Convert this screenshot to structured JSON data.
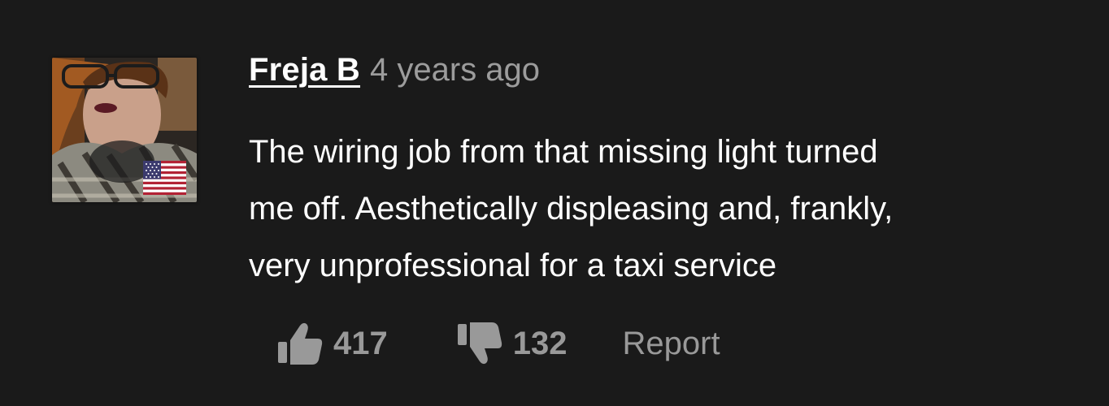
{
  "comment": {
    "author": "Freja B",
    "timestamp": "4 years ago",
    "body_lines": [
      "The wiring job from that missing light turned",
      "me off. Aesthetically displeasing and, frankly,",
      "very unprofessional for a taxi service"
    ],
    "avatar_icon": "user-avatar-photo",
    "country_flag_icon": "us-flag-icon"
  },
  "actions": {
    "upvote_icon": "thumbs-up-icon",
    "upvote_count": "417",
    "downvote_icon": "thumbs-down-icon",
    "downvote_count": "132",
    "report_label": "Report"
  },
  "colors": {
    "background": "#1a1a1a",
    "text_primary": "#ffffff",
    "text_muted": "#9c9c9c"
  }
}
